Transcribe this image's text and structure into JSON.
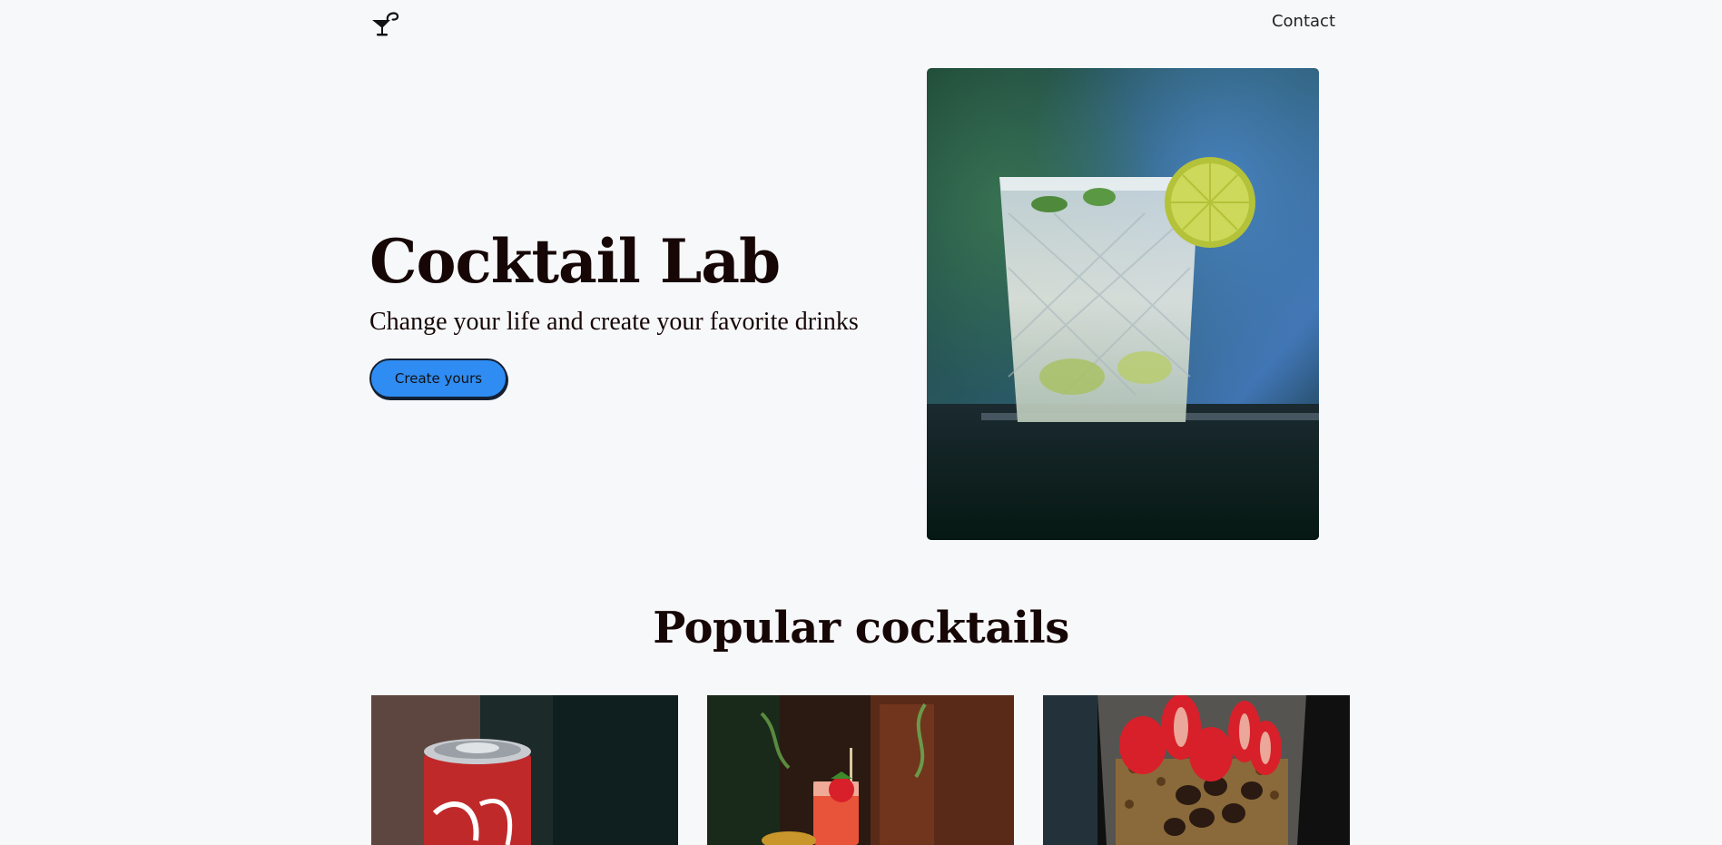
{
  "nav": {
    "logo_icon": "cocktail-glass-icon",
    "contact_label": "Contact"
  },
  "hero": {
    "title": "Cocktail Lab",
    "subtitle": "Change your life and create your favorite drinks",
    "cta_label": "Create yours",
    "image_icon": "lime-cocktail-photo"
  },
  "popular": {
    "title": "Popular cocktails",
    "cards": [
      {
        "image": "cola-can-photo"
      },
      {
        "image": "strawberry-cocktail-photo"
      },
      {
        "image": "strawberry-parfait-photo"
      }
    ]
  },
  "colors": {
    "background": "#f7f8fa",
    "text": "#160606",
    "accent": "#2f8cf2"
  }
}
